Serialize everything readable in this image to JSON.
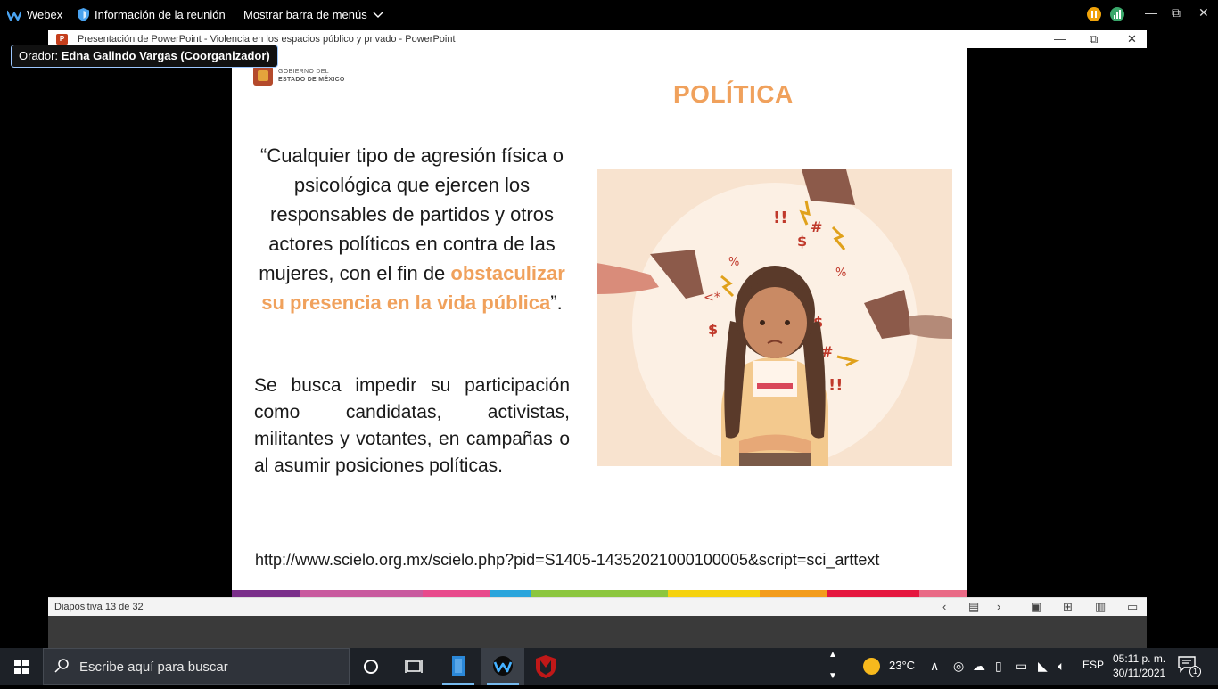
{
  "webex_bar": {
    "app_name": "Webex",
    "meeting_info": "Información de la reunión",
    "menu_toggle": "Mostrar barra de menús"
  },
  "ppt_window": {
    "title": "Presentación de PowerPoint  -  Violencia en los espacios público y privado - PowerPoint"
  },
  "speaker": {
    "prefix": "Orador:",
    "name": "Edna Galindo Vargas (Coorganizador)"
  },
  "slide": {
    "logo_line1": "GOBIERNO DEL",
    "logo_line2": "ESTADO DE MÉXICO",
    "heading": "POLÍTICA",
    "quote_part1": "“Cualquier tipo de agresión física o psicológica que ejercen los responsables de partidos y otros actores políticos en contra de las mujeres, con el fin de ",
    "quote_highlight": "obstaculizar su presencia en la vida pública",
    "quote_part2": "”.",
    "paragraph": "Se busca impedir su participación como candidatas, activistas, militantes y votantes, en campañas o al asumir posiciones políticas.",
    "source_url": "http://www.scielo.org.mx/scielo.php?pid=S1405-14352021000100005&script=sci_arttext",
    "strip_colors": [
      "#7a2f8a",
      "#c85a9e",
      "#e84a8c",
      "#2aa5dc",
      "#8cc63f",
      "#f5d20f",
      "#f39c1c",
      "#e5173f",
      "#e96a86"
    ]
  },
  "status_bar": {
    "slide_counter": "Diapositiva 13 de 32"
  },
  "taskbar": {
    "search_placeholder": "Escribe aquí para buscar",
    "weather_temp": "23°C",
    "language": "ESP",
    "time": "05:11 p. m.",
    "date": "30/11/2021",
    "notifications_count": "1"
  },
  "colors": {
    "accent_orange": "#f0a15c",
    "webex_bg": "#000000",
    "taskbar_bg": "#1d2127"
  }
}
